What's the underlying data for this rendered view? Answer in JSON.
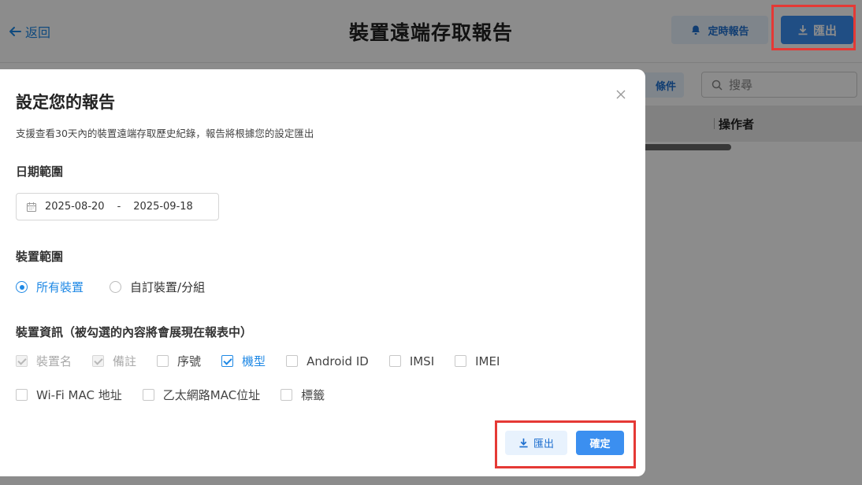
{
  "header": {
    "back_label": "返回",
    "title": "裝置遠端存取報告",
    "schedule_label": "定時報告",
    "export_label": "匯出"
  },
  "background": {
    "filter_label": "條件",
    "search_placeholder": "搜尋",
    "column_operator": "操作者"
  },
  "modal": {
    "title": "設定您的報告",
    "description": "支援查看30天內的裝置遠端存取歷史紀錄，報告將根據您的設定匯出",
    "date_section": "日期範圍",
    "date_start": "2025-08-20",
    "date_separator": "-",
    "date_end": "2025-09-18",
    "device_section": "裝置範圍",
    "radio_all": "所有裝置",
    "radio_custom": "自訂裝置/分組",
    "info_section": "裝置資訊（被勾選的內容將會展現在報表中）",
    "fields": {
      "device_name": "裝置名",
      "note": "備註",
      "serial": "序號",
      "model": "機型",
      "android_id": "Android ID",
      "imsi": "IMSI",
      "imei": "IMEI",
      "wifi_mac": "Wi-Fi MAC 地址",
      "ethernet_mac": "乙太網路MAC位址",
      "tag": "標籤"
    },
    "export_label": "匯出",
    "confirm_label": "確定"
  },
  "colors": {
    "primary": "#3b8ff0",
    "light_primary": "#e8f2fd",
    "highlight": "#e53935"
  }
}
